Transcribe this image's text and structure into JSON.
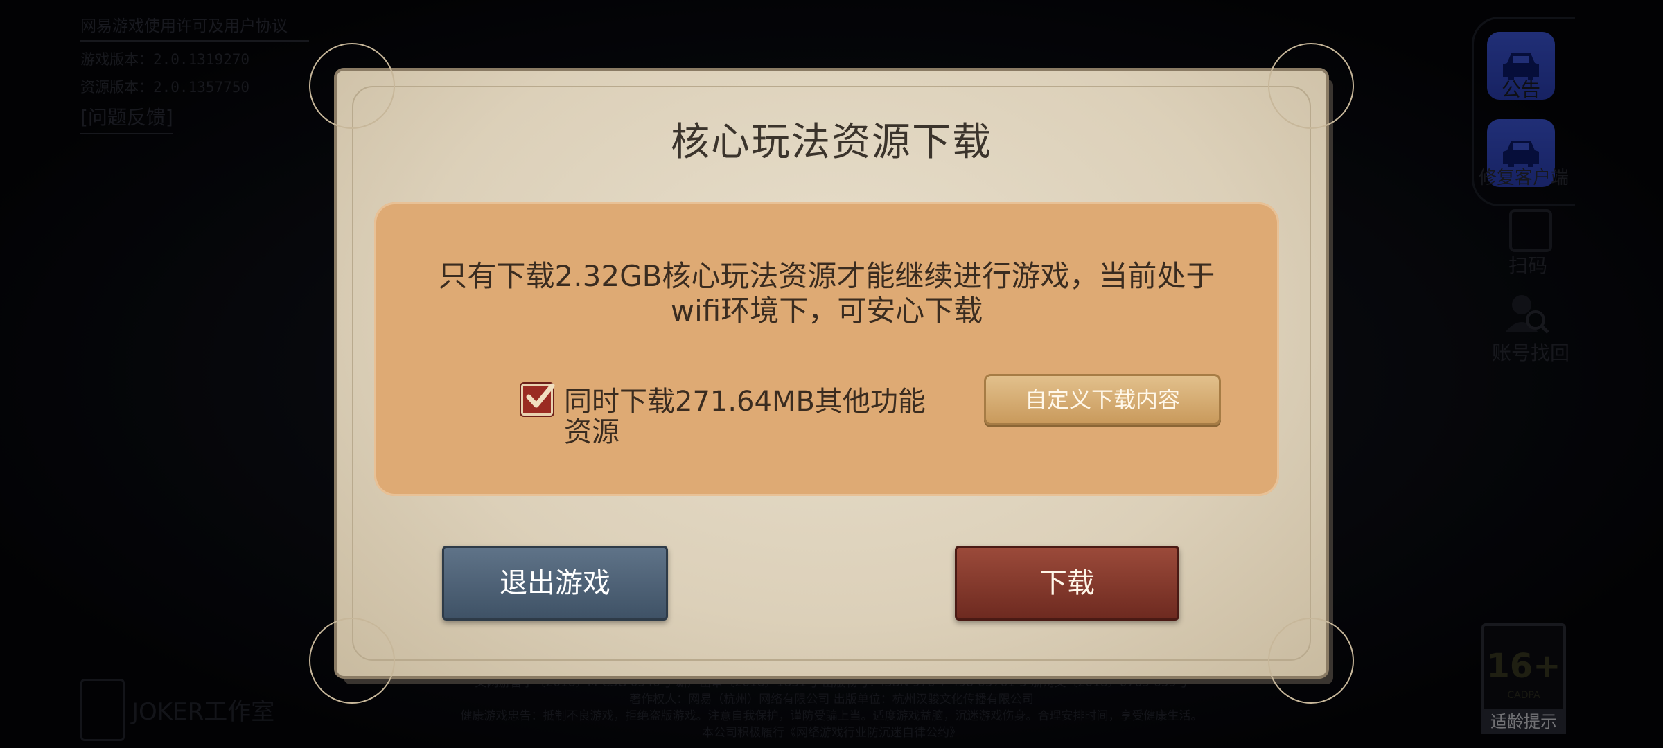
{
  "background": {
    "license_link": "网易游戏使用许可及用户协议",
    "game_version": "游戏版本：2.0.1319270",
    "resource_version": "资源版本：2.0.1357750",
    "feedback_link": "[问题反馈]",
    "studio_logo": "JOKER工作室",
    "footer_lines": [
      "文网游备字〔2018〕M-CSG 0540号  新广出审〔2018〕1831号  出版物号：ISBN 978-7-498-05761-5  浙网文〔2018〕0765-055号",
      "著作权人：网易（杭州）网络有限公司  出版单位：杭州汉骏文化传播有限公司",
      "健康游戏忠告：抵制不良游戏，拒绝盗版游戏。注意自我保护，谨防受骗上当。适度游戏益脑，沉迷游戏伤身。合理安排时间，享受健康生活。",
      "本公司积极履行《网络游戏行业防沉迷自律公约》"
    ]
  },
  "side_panel": {
    "button1_label": "公告",
    "button2_label": "修复客户端",
    "scan_label": "扫码",
    "account_recover_label": "账号找回"
  },
  "age_rating": {
    "value": "16+",
    "org": "CADPA",
    "tip": "适龄提示"
  },
  "dialog": {
    "title": "核心玩法资源下载",
    "message_line1": "只有下载2.32GB核心玩法资源才能继续进行游戏，当前处于",
    "message_line2": "wifi环境下，可安心下载",
    "option_checked": true,
    "option_text": "同时下载271.64MB其他功能资源",
    "custom_button": "自定义下载内容",
    "exit_button": "退出游戏",
    "download_button": "下载"
  },
  "colors": {
    "accent_blue": "#3c56d8",
    "exit_button": "#4f6378",
    "download_button": "#87392c",
    "panel": "#deaa74"
  }
}
